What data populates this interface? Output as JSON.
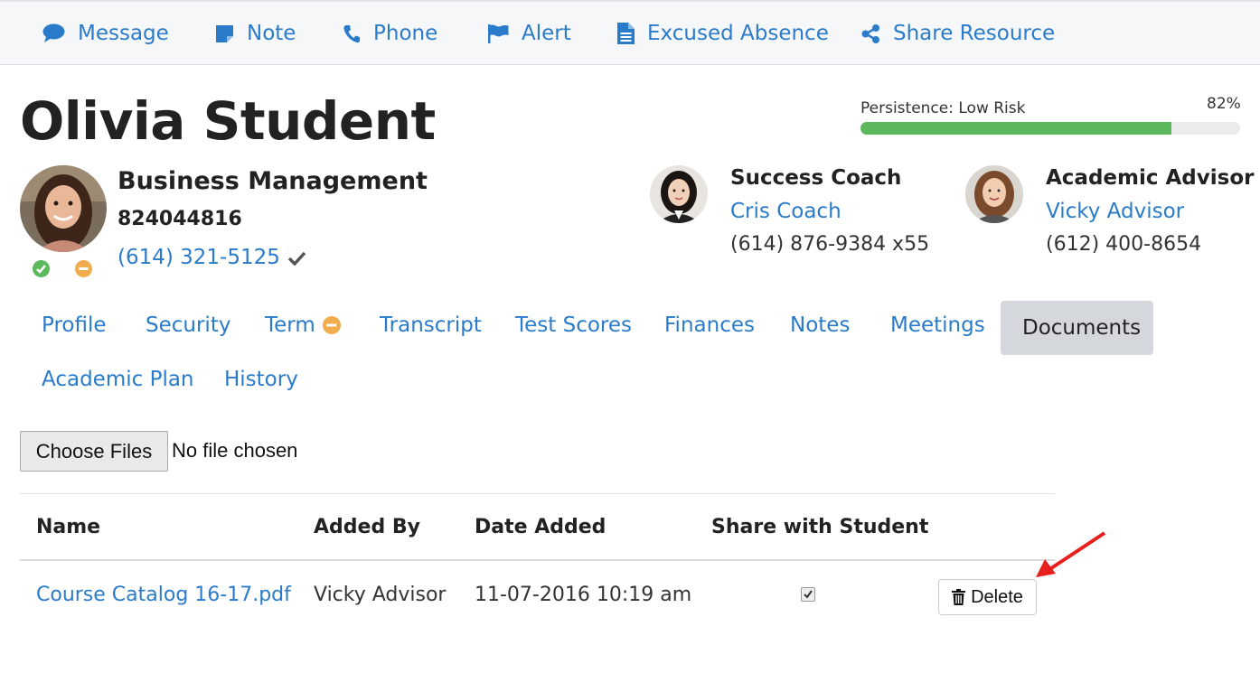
{
  "toolbar": {
    "message": "Message",
    "note": "Note",
    "phone": "Phone",
    "alert": "Alert",
    "excused_absence": "Excused Absence",
    "share_resource": "Share Resource"
  },
  "student": {
    "name": "Olivia Student",
    "program": "Business Management",
    "id": "824044816",
    "phone": "(614) 321-5125"
  },
  "persistence": {
    "label": "Persistence: Low Risk",
    "percent_label": "82%",
    "percent": 0.82,
    "color": "#5cb85c"
  },
  "coach": {
    "role": "Success Coach",
    "name": "Cris Coach",
    "phone": "(614) 876-9384 x55"
  },
  "advisor": {
    "role": "Academic Advisor",
    "name": "Vicky Advisor",
    "phone": "(612) 400-8654"
  },
  "tabs": [
    {
      "label": "Profile"
    },
    {
      "label": "Security"
    },
    {
      "label": "Term"
    },
    {
      "label": "Transcript"
    },
    {
      "label": "Test Scores"
    },
    {
      "label": "Finances"
    },
    {
      "label": "Notes"
    },
    {
      "label": "Meetings"
    },
    {
      "label": "Documents"
    },
    {
      "label": "Academic Plan"
    },
    {
      "label": "History"
    }
  ],
  "upload": {
    "button": "Choose Files",
    "status": "No file chosen"
  },
  "table": {
    "headers": [
      "Name",
      "Added By",
      "Date Added",
      "Share with Student"
    ],
    "rows": [
      {
        "name": "Course Catalog 16-17.pdf",
        "added_by": "Vicky Advisor",
        "date_added": "11-07-2016 10:19 am",
        "share": true,
        "delete_label": "Delete"
      }
    ]
  },
  "colors": {
    "link": "#2a7bc9",
    "success": "#5cb85c",
    "warning": "#f0ad4e",
    "annotation_arrow": "#e8201d"
  }
}
